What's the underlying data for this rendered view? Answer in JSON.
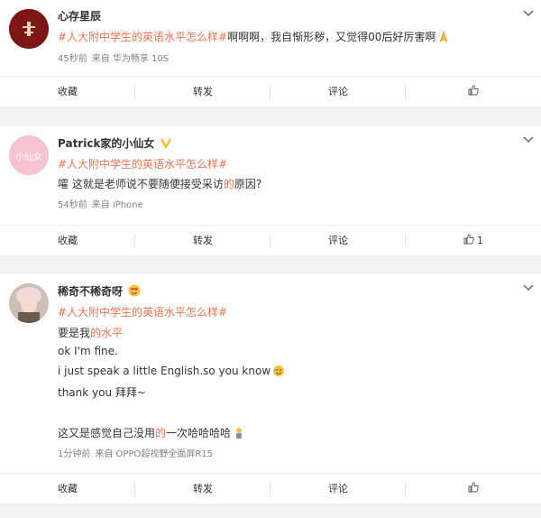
{
  "posts": [
    {
      "username": "心存星辰",
      "hashtag": "#人大附中学生的英语水平怎么样#",
      "text": "啊啊啊，我自惭形秽，又觉得00后好厉害啊",
      "time": "45秒前",
      "source": "来自 华为畅享 10S",
      "actions": {
        "collect": "收藏",
        "repost": "转发",
        "comment": "评论",
        "likes": ""
      }
    },
    {
      "username": "Patrick家的小仙女",
      "hashtag": "#人大附中学生的英语水平怎么样#",
      "text_a": "嚯 这就是老师说不要随便接受采访",
      "text_hl": "的",
      "text_b": "原因?",
      "time": "54秒前",
      "source": "来自 iPhone",
      "avatar_text": "小仙女",
      "actions": {
        "collect": "收藏",
        "repost": "转发",
        "comment": "评论",
        "likes": "1"
      }
    },
    {
      "username": "稀奇不稀奇呀",
      "hashtag": "#人大附中学生的英语水平怎么样#",
      "line1_a": "要是我",
      "line1_hl": "的水平",
      "line2": "ok I'm fine.",
      "line3": "i just speak a little English.so you know",
      "line4": "thank you 拜拜~",
      "line5_a": "这又是感觉自己没用",
      "line5_hl": "的",
      "line5_b": "一次哈哈哈哈",
      "time": "1分钟前",
      "source": "来自 OPPO超视野全面屏R15",
      "actions": {
        "collect": "收藏",
        "repost": "转发",
        "comment": "评论",
        "likes": ""
      }
    }
  ],
  "colors": {
    "accent": "#eb7350",
    "meta": "#808080",
    "background": "#f2f2f5"
  }
}
